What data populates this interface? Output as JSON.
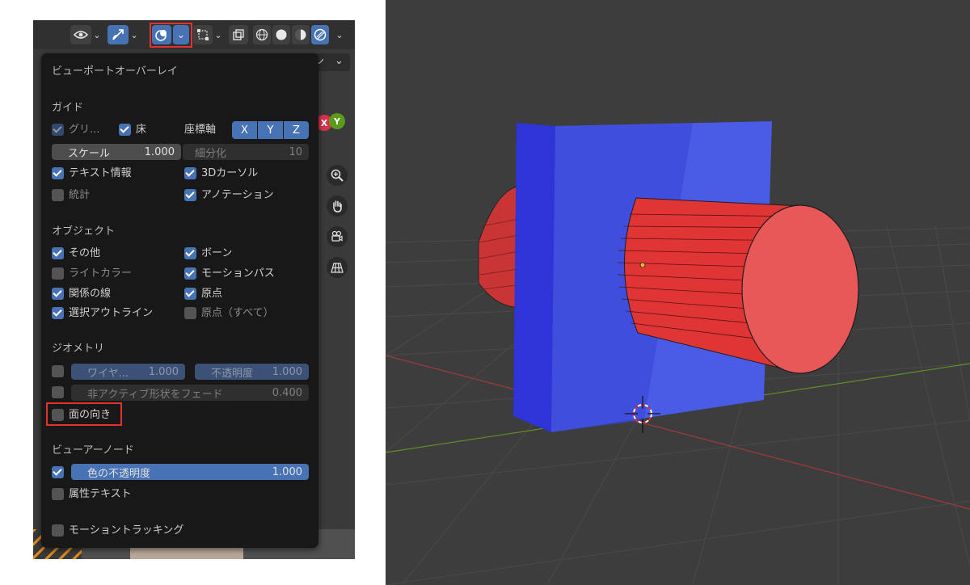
{
  "popup": {
    "title": "ビューポートオーバーレイ",
    "guides": {
      "header": "ガイド",
      "grid": "グリ...",
      "floor": "床",
      "axes_label": "座標軸",
      "axes": [
        "X",
        "Y",
        "Z"
      ],
      "scale_label": "スケール",
      "scale_value": "1.000",
      "subdivisions_label": "細分化",
      "subdivisions_value": "10",
      "text_info": "テキスト情報",
      "cursor_3d": "3Dカーソル",
      "statistics": "統計",
      "annotations": "アノテーション"
    },
    "objects": {
      "header": "オブジェクト",
      "extras": "その他",
      "bones": "ボーン",
      "light_colors": "ライトカラー",
      "motion_paths": "モーションパス",
      "relationship_lines": "関係の線",
      "origins": "原点",
      "outline_selected": "選択アウトライン",
      "origins_all": "原点（すべて）"
    },
    "geometry": {
      "header": "ジオメトリ",
      "wireframe_label": "ワイヤ...",
      "wireframe_value": "1.000",
      "opacity_label": "不透明度",
      "opacity_value": "1.000",
      "fade_label": "非アクティブ形状をフェード",
      "fade_value": "0.400",
      "face_orientation": "面の向き"
    },
    "viewer_node": {
      "header": "ビューアーノード",
      "color_opacity_label": "色の不透明度",
      "color_opacity_value": "1.000",
      "attribute_text": "属性テキスト"
    },
    "motion_tracking": "モーショントラッキング"
  },
  "behind_text": "ン",
  "gizmo": {
    "x": "X",
    "y": "Y"
  },
  "colors": {
    "accent": "#4772b3",
    "highlight_frame": "#e5322d",
    "face_front": "#4a5be6",
    "face_back": "#e84545"
  }
}
